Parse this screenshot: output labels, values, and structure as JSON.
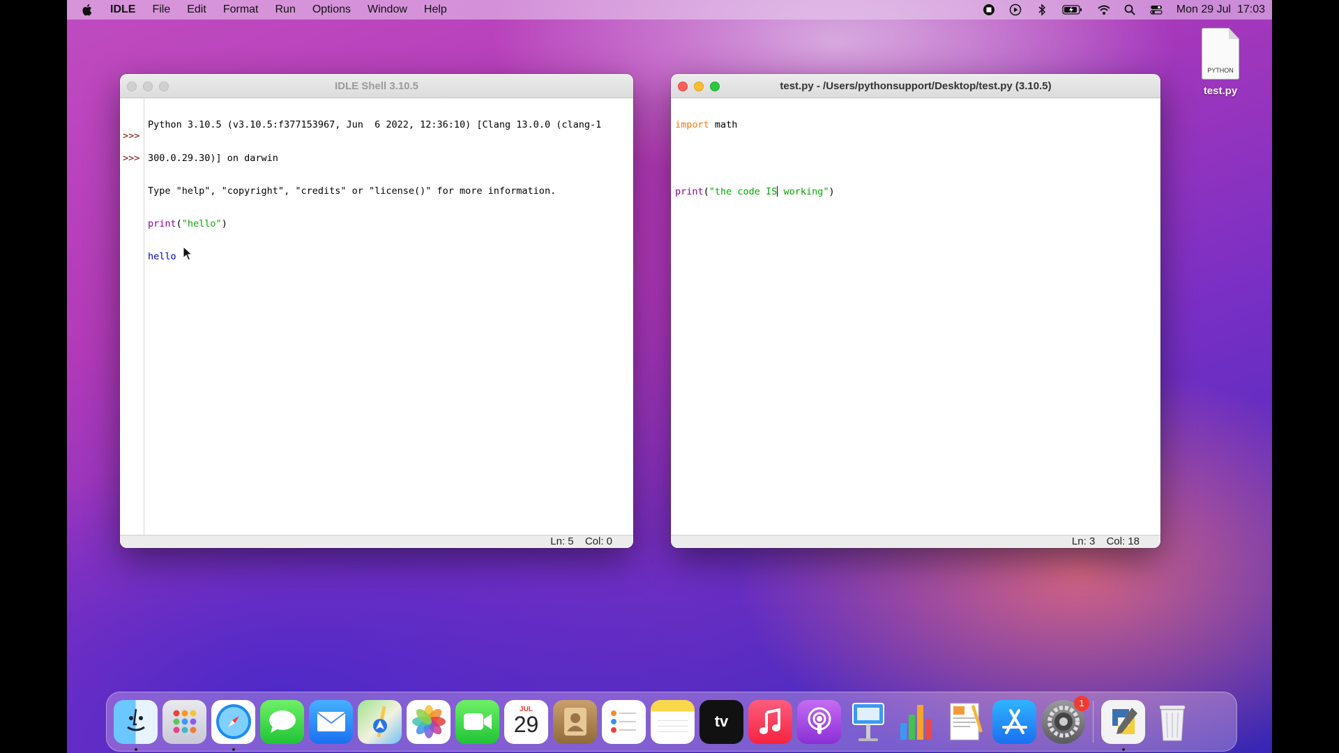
{
  "menubar": {
    "app_name": "IDLE",
    "items": [
      "File",
      "Edit",
      "Format",
      "Run",
      "Options",
      "Window",
      "Help"
    ],
    "clock": "Mon 29 Jul  17:03"
  },
  "shell_window": {
    "title": "IDLE Shell 3.10.5",
    "lines": [
      "Python 3.10.5 (v3.10.5:f377153967, Jun  6 2022, 12:36:10) [Clang 13.0.0 (clang-1",
      "300.0.29.30)] on darwin",
      "Type \"help\", \"copyright\", \"credits\" or \"license()\" for more information."
    ],
    "prompt": ">>>",
    "command_builtin": "print",
    "command_open": "(",
    "command_string": "\"hello\"",
    "command_close": ")",
    "output": "hello",
    "status_ln": "Ln: 5",
    "status_col": "Col: 0"
  },
  "editor_window": {
    "title": "test.py - /Users/pythonsupport/Desktop/test.py (3.10.5)",
    "line1_keyword": "import",
    "line1_rest": " math",
    "line3_builtin": "print",
    "line3_open": "(",
    "line3_string_a": "\"the code IS",
    "line3_string_b": " working\"",
    "line3_close": ")",
    "status_ln": "Ln: 3",
    "status_col": "Col: 18"
  },
  "desktop_file": {
    "label": "test.py",
    "icon_text": "PYTHON"
  },
  "dock": {
    "calendar_month": "JUL",
    "calendar_day": "29",
    "appletv_label": "tv",
    "settings_badge": "1",
    "items": [
      "finder-icon",
      "launchpad-icon",
      "safari-icon",
      "messages-icon",
      "mail-icon",
      "maps-icon",
      "photos-icon",
      "facetime-icon",
      "calendar-icon",
      "contacts-icon",
      "reminders-icon",
      "notes-icon",
      "appletv-icon",
      "music-icon",
      "podcasts-icon",
      "keynote-icon",
      "numbers-icon",
      "pages-icon",
      "appstore-icon",
      "system-preferences-icon",
      "python-idle-icon",
      "trash-icon"
    ]
  }
}
